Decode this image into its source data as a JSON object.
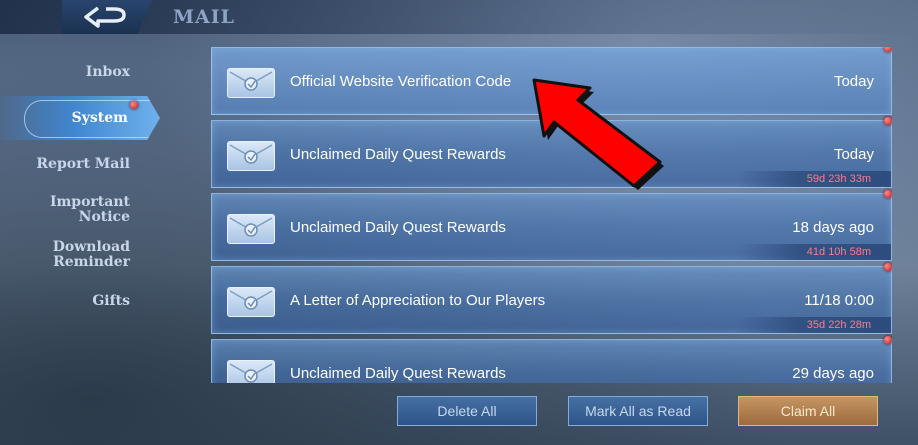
{
  "header": {
    "title": "MAIL",
    "back_icon": "back-arrow-icon"
  },
  "sidebar": {
    "items": [
      {
        "label": "Inbox"
      },
      {
        "label": "System",
        "active": true,
        "has_notification": true
      },
      {
        "label": "Report Mail"
      },
      {
        "label": "Important Notice"
      },
      {
        "label": "Download Reminder"
      },
      {
        "label": "Gifts"
      }
    ]
  },
  "mails": [
    {
      "subject": "Official Website Verification Code",
      "date": "Today",
      "expires": ""
    },
    {
      "subject": "Unclaimed Daily Quest Rewards",
      "date": "Today",
      "expires": "59d 23h 33m"
    },
    {
      "subject": "Unclaimed Daily Quest Rewards",
      "date": "18 days ago",
      "expires": "41d 10h 58m"
    },
    {
      "subject": "A Letter of Appreciation to Our Players",
      "date": "11/18 0:00",
      "expires": "35d 22h 28m"
    },
    {
      "subject": "Unclaimed Daily Quest Rewards",
      "date": "29 days ago",
      "expires": ""
    }
  ],
  "footer": {
    "delete_all": "Delete All",
    "mark_all_read": "Mark All as Read",
    "claim_all": "Claim All"
  },
  "colors": {
    "accent": "#3f86cf",
    "notify_dot": "#c21a1a",
    "timer": "#ff7a8a",
    "claim": "#c59563",
    "arrow": "#ff0000"
  }
}
